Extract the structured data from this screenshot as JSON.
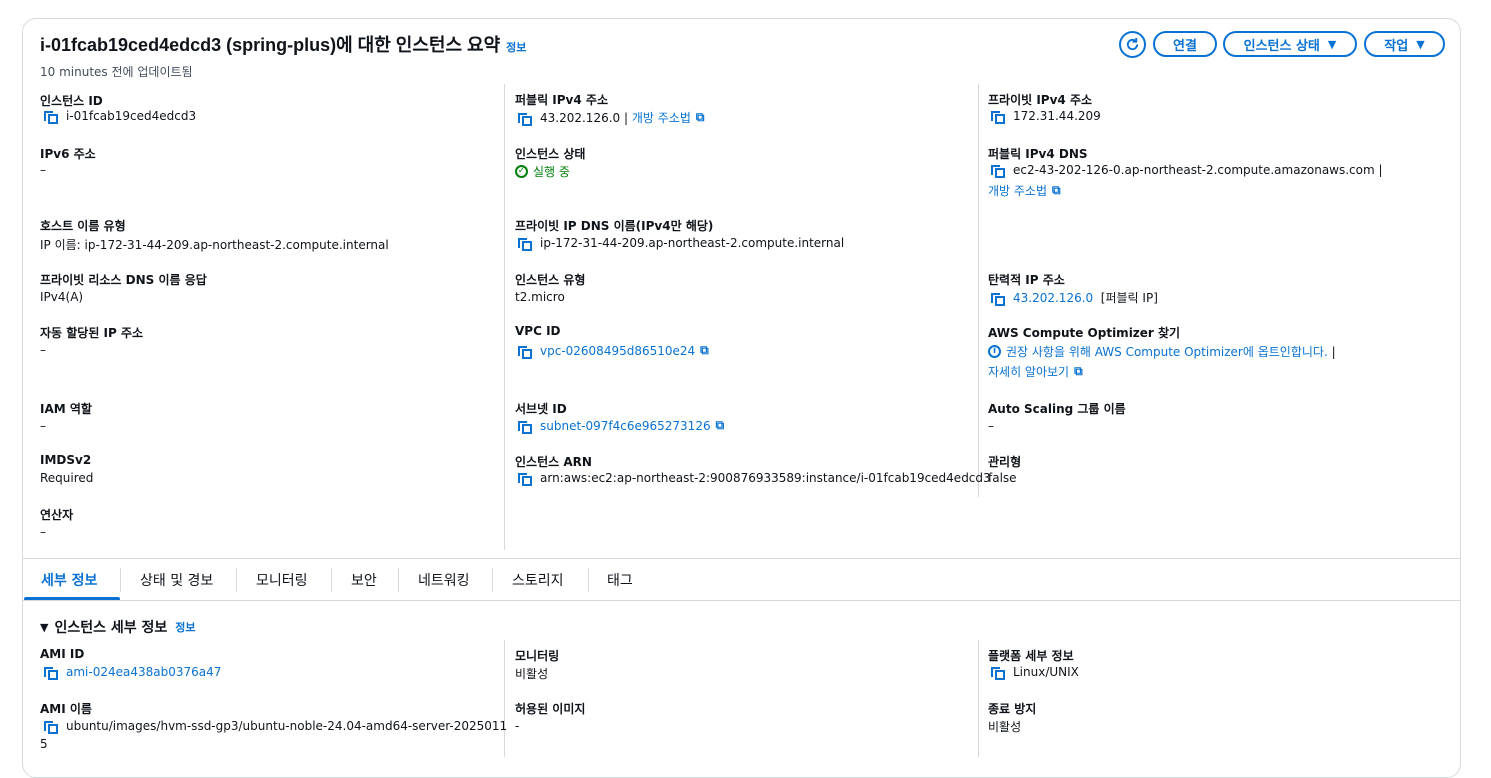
{
  "header": {
    "title": "i-01fcab19ced4edcd3 (spring-plus)에 대한 인스턴스 요약",
    "info_link": "정보",
    "updated": "10 minutes 전에 업데이트됨",
    "buttons": {
      "connect": "연결",
      "instance_state": "인스턴스 상태",
      "actions": "작업"
    }
  },
  "summary": {
    "instance_id": {
      "label": "인스턴스 ID",
      "value": "i-01fcab19ced4edcd3"
    },
    "ipv6": {
      "label": "IPv6 주소",
      "value": "–"
    },
    "hostname_type": {
      "label": "호스트 이름 유형",
      "value": "IP 이름: ip-172-31-44-209.ap-northeast-2.compute.internal"
    },
    "private_dns_answer": {
      "label": "프라이빗 리소스 DNS 이름 응답",
      "value": "IPv4(A)"
    },
    "auto_ip": {
      "label": "자동 할당된 IP 주소",
      "value": "–"
    },
    "iam_role": {
      "label": "IAM 역할",
      "value": "–"
    },
    "imdsv2": {
      "label": "IMDSv2",
      "value": "Required"
    },
    "operator": {
      "label": "연산자",
      "value": "–"
    },
    "public_ipv4": {
      "label": "퍼블릭 IPv4 주소",
      "value": "43.202.126.0 |",
      "link": "개방 주소법"
    },
    "instance_state": {
      "label": "인스턴스 상태",
      "value": "실행 중"
    },
    "private_ip_dns": {
      "label": "프라이빗 IP DNS 이름(IPv4만 해당)",
      "value": "ip-172-31-44-209.ap-northeast-2.compute.internal"
    },
    "instance_type": {
      "label": "인스턴스 유형",
      "value": "t2.micro"
    },
    "vpc_id": {
      "label": "VPC ID",
      "value": "vpc-02608495d86510e24"
    },
    "subnet_id": {
      "label": "서브넷 ID",
      "value": "subnet-097f4c6e965273126"
    },
    "instance_arn": {
      "label": "인스턴스 ARN",
      "value": "arn:aws:ec2:ap-northeast-2:900876933589:instance/i-01fcab19ced4edcd3"
    },
    "private_ipv4": {
      "label": "프라이빗 IPv4 주소",
      "value": "172.31.44.209"
    },
    "public_dns": {
      "label": "퍼블릭 IPv4 DNS",
      "value": "ec2-43-202-126-0.ap-northeast-2.compute.amazonaws.com |",
      "link": "개방 주소법"
    },
    "elastic_ip": {
      "label": "탄력적 IP 주소",
      "value": "43.202.126.0",
      "suffix": "[퍼블릭 IP]"
    },
    "compute_optimizer": {
      "label": "AWS Compute Optimizer 찾기",
      "value": "권장 사항을 위해 AWS Compute Optimizer에 옵트인합니다.",
      "sep": "|",
      "link": "자세히 알아보기"
    },
    "asg": {
      "label": "Auto Scaling 그룹 이름",
      "value": "–"
    },
    "managed": {
      "label": "관리형",
      "value": "false"
    }
  },
  "tabs": [
    "세부 정보",
    "상태 및 경보",
    "모니터링",
    "보안",
    "네트워킹",
    "스토리지",
    "태그"
  ],
  "details": {
    "title": "인스턴스 세부 정보",
    "info_link": "정보",
    "ami_id": {
      "label": "AMI ID",
      "value": "ami-024ea438ab0376a47"
    },
    "ami_name": {
      "label": "AMI 이름",
      "value_line1": "ubuntu/images/hvm-ssd-gp3/ubuntu-noble-24.04-amd64-server-2025011",
      "value_line2": "5"
    },
    "monitoring": {
      "label": "모니터링",
      "value": "비활성"
    },
    "allowed_image": {
      "label": "허용된 이미지",
      "value": "-"
    },
    "platform": {
      "label": "플랫폼 세부 정보",
      "value": "Linux/UNIX"
    },
    "termination_protection": {
      "label": "종료 방지",
      "value": "비활성"
    }
  }
}
